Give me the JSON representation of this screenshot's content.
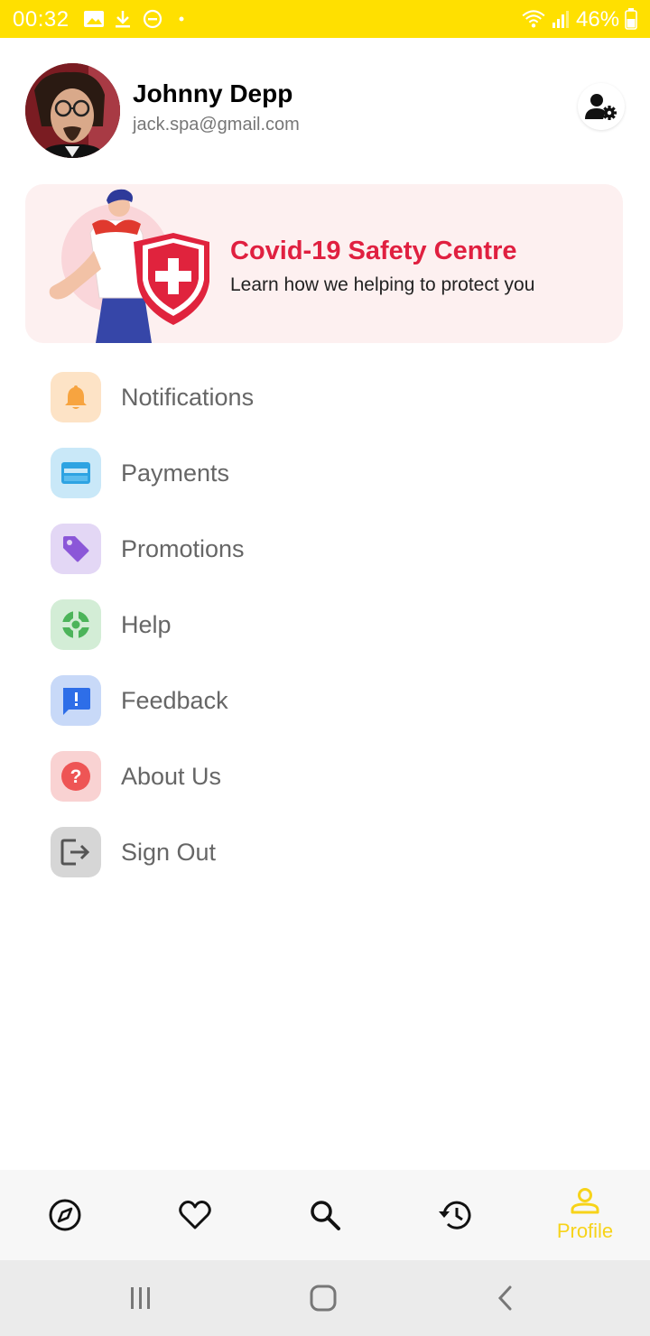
{
  "status_bar": {
    "time": "00:32",
    "battery_text": "46%",
    "icons": [
      "image-icon",
      "download-icon",
      "do-not-disturb-icon",
      "dot-icon",
      "wifi-icon",
      "signal-icon",
      "battery-icon"
    ]
  },
  "profile": {
    "name": "Johnny Depp",
    "email": "jack.spa@gmail.com",
    "settings_icon": "user-settings-icon"
  },
  "banner": {
    "title": "Covid-19 Safety Centre",
    "subtitle": "Learn how we helping to protect you",
    "title_color": "#E02040",
    "background": "#FDF0F0"
  },
  "menu": {
    "items": [
      {
        "label": "Notifications",
        "icon": "bell-icon",
        "icon_color": "#F7A440",
        "bg": "#FDE3C6"
      },
      {
        "label": "Payments",
        "icon": "card-icon",
        "icon_color": "#2EA3E2",
        "bg": "#C9E8F8"
      },
      {
        "label": "Promotions",
        "icon": "tag-icon",
        "icon_color": "#8B57D8",
        "bg": "#E3D7F5"
      },
      {
        "label": "Help",
        "icon": "lifebuoy-icon",
        "icon_color": "#4CB45A",
        "bg": "#D3EDD6"
      },
      {
        "label": "Feedback",
        "icon": "feedback-icon",
        "icon_color": "#2E6EE8",
        "bg": "#C8D9F8"
      },
      {
        "label": "About Us",
        "icon": "question-icon",
        "icon_color": "#EE5555",
        "bg": "#F9D2D2"
      },
      {
        "label": "Sign Out",
        "icon": "sign-out-icon",
        "icon_color": "#555555",
        "bg": "#D6D6D6"
      }
    ]
  },
  "bottom_nav": {
    "items": [
      {
        "icon": "compass-icon"
      },
      {
        "icon": "heart-icon"
      },
      {
        "icon": "search-icon"
      },
      {
        "icon": "history-icon"
      },
      {
        "icon": "profile-icon",
        "label": "Profile",
        "active": true
      }
    ],
    "active_color": "#F7D31A"
  },
  "system_nav": {
    "icons": [
      "recents-icon",
      "home-icon",
      "back-icon"
    ]
  },
  "colors": {
    "accent": "#FFE000"
  }
}
